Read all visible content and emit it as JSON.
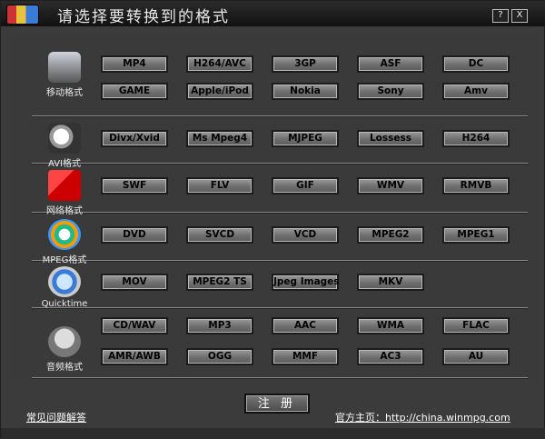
{
  "window": {
    "title": "请选择要转换到的格式",
    "help_label": "?",
    "close_label": "X"
  },
  "categories": [
    {
      "label": "移动格式",
      "icon": "mobile-phone-icon",
      "buttons": [
        "MP4",
        "H264/AVC",
        "3GP",
        "ASF",
        "DC",
        "GAME",
        "Apple/iPod",
        "Nokia",
        "Sony",
        "Amv"
      ]
    },
    {
      "label": "AVI格式",
      "icon": "avi-film-reel-icon",
      "buttons": [
        "Divx/Xvid",
        "Ms Mpeg4",
        "MJPEG",
        "Lossess",
        "H264"
      ]
    },
    {
      "label": "网络格式",
      "icon": "flash-icon",
      "buttons": [
        "SWF",
        "FLV",
        "GIF",
        "WMV",
        "RMVB"
      ]
    },
    {
      "label": "MPEG格式",
      "icon": "mpeg-disc-icon",
      "buttons": [
        "DVD",
        "SVCD",
        "VCD",
        "MPEG2",
        "MPEG1"
      ]
    },
    {
      "label": "Quicktime",
      "icon": "quicktime-icon",
      "buttons": [
        "MOV",
        "MPEG2 TS",
        "Jpeg Images",
        "MKV"
      ]
    },
    {
      "label": "音频格式",
      "icon": "audio-headphones-icon",
      "buttons": [
        "CD/WAV",
        "MP3",
        "AAC",
        "WMA",
        "FLAC",
        "AMR/AWB",
        "OGG",
        "MMF",
        "AC3",
        "AU"
      ]
    }
  ],
  "footer": {
    "faq_link": "常见问题解答",
    "register_label": "注 册",
    "homepage_label": "官方主页：http://china.winmpg.com"
  }
}
